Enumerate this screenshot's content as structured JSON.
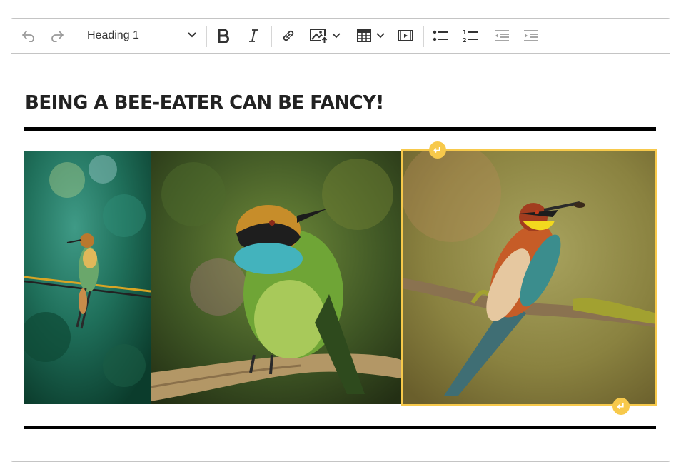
{
  "toolbar": {
    "undo_icon": "undo-icon",
    "redo_icon": "redo-icon",
    "heading_value": "Heading 1",
    "buttons": [
      "bold",
      "italic",
      "link",
      "insert-image",
      "table",
      "media-embed",
      "bulleted-list",
      "numbered-list",
      "outdent",
      "indent"
    ]
  },
  "document": {
    "title": "BEING A BEE-EATER CAN BE FANCY!",
    "images": [
      {
        "alt": "bee-eater on a wire",
        "selected": false
      },
      {
        "alt": "green bee-eater on a branch",
        "selected": false
      },
      {
        "alt": "european bee-eater with insect",
        "selected": true
      }
    ]
  },
  "colors": {
    "selection": "#f7c94b",
    "rule": "#000000",
    "border": "#c4c4c4"
  }
}
